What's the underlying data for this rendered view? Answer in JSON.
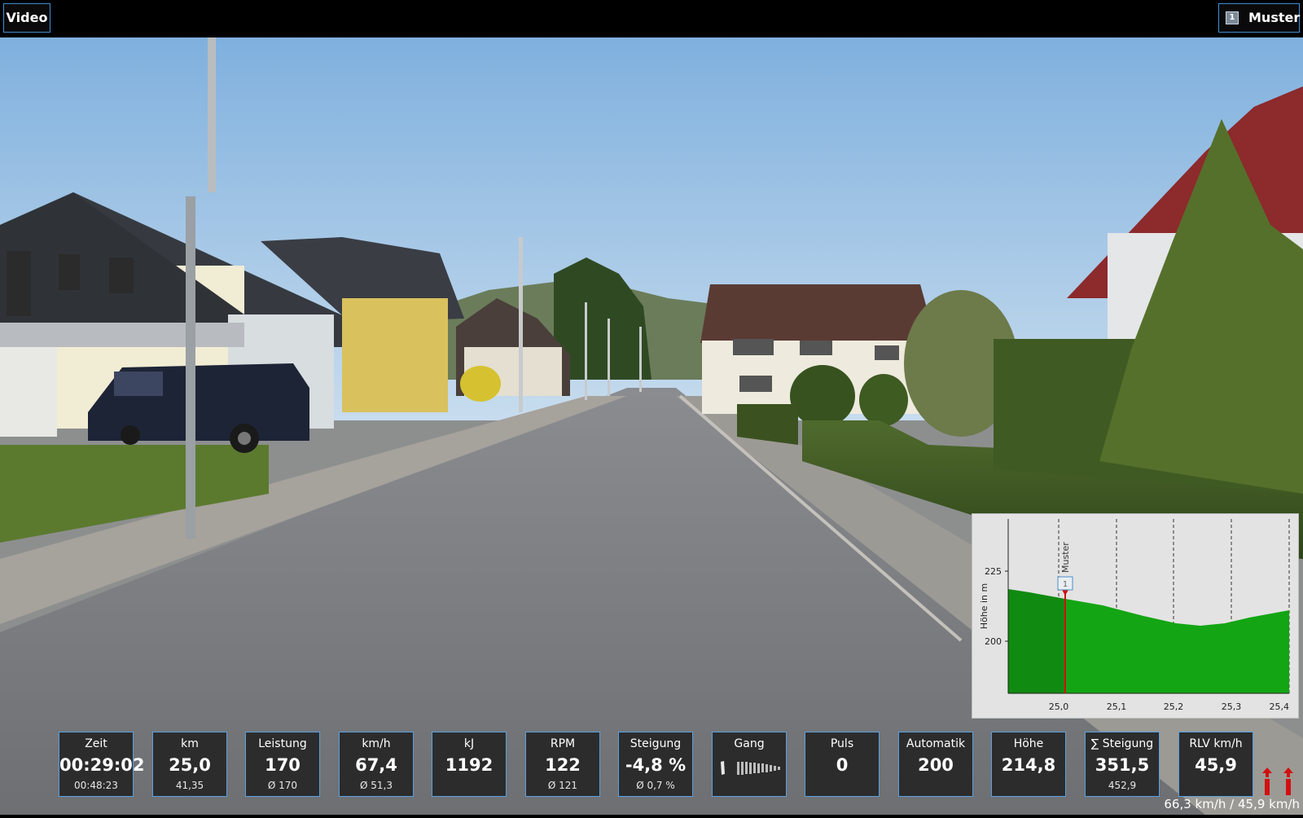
{
  "topbar": {
    "video_button": "Video",
    "rider": {
      "badge": "1",
      "name": "Muster"
    }
  },
  "elevation_chart": {
    "ylabel": "Höhe in m",
    "y_ticks": [
      "225",
      "200"
    ],
    "x_ticks": [
      "25,0",
      "25,1",
      "25,2",
      "25,3",
      "25,4"
    ],
    "rider_label": "Muster",
    "rider_badge": "1",
    "fill_color": "#13a513",
    "passed_color": "#118a11"
  },
  "metrics": [
    {
      "label": "Zeit",
      "value": "00:29:02",
      "sub": "00:48:23"
    },
    {
      "label": "km",
      "value": "25,0",
      "sub": "41,35"
    },
    {
      "label": "Leistung",
      "value": "170",
      "sub": "Ø 170"
    },
    {
      "label": "km/h",
      "value": "67,4",
      "sub": "Ø 51,3"
    },
    {
      "label": "kJ",
      "value": "1192",
      "sub": ""
    },
    {
      "label": "RPM",
      "value": "122",
      "sub": "Ø 121"
    },
    {
      "label": "Steigung",
      "value": "-4,8 %",
      "sub": "Ø 0,7 %"
    },
    {
      "label": "Gang",
      "value": "",
      "sub": ""
    },
    {
      "label": "Puls",
      "value": "0",
      "sub": ""
    },
    {
      "label": "Automatik",
      "value": "200",
      "sub": ""
    },
    {
      "label": "Höhe",
      "value": "214,8",
      "sub": ""
    },
    {
      "label": "∑ Steigung",
      "value": "351,5",
      "sub": "452,9"
    },
    {
      "label": "RLV km/h",
      "value": "45,9",
      "sub": ""
    }
  ],
  "speed_readout": "66,3 km/h / 45,9 km/h",
  "colors": {
    "accent_border": "#5aa0df",
    "tile_bg": "#2c2c2c",
    "shift_arrow": "#d11010"
  }
}
